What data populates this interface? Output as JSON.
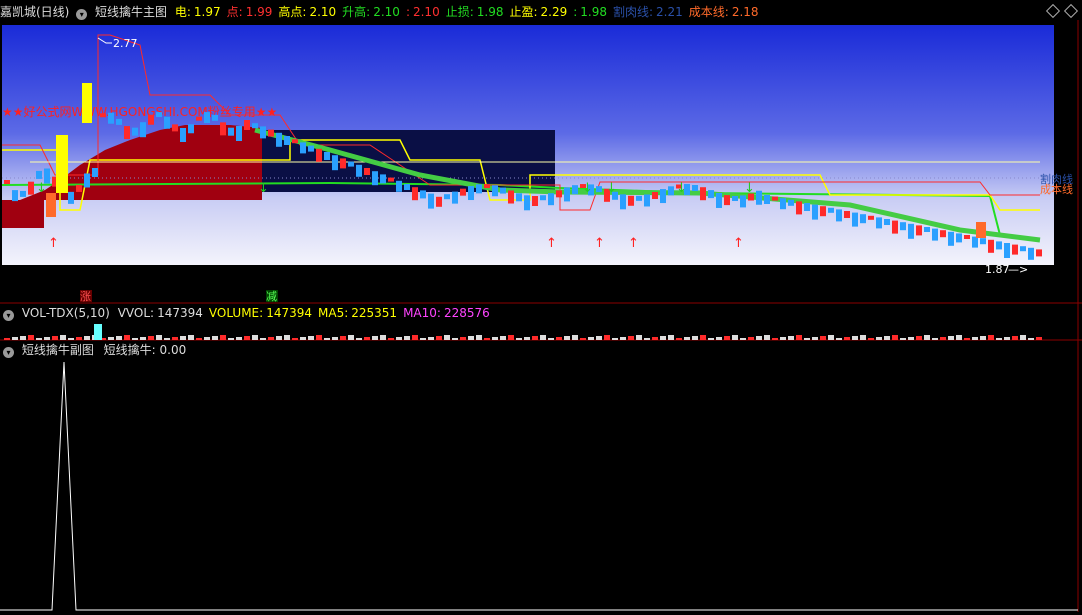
{
  "main": {
    "stock": "嘉凯城(日线)",
    "indicator": "短线擒牛主图",
    "items": [
      {
        "k": "电:",
        "v": "1.97",
        "kc": "#ffff00",
        "vc": "#ffff00"
      },
      {
        "k": "点:",
        "v": "1.99",
        "kc": "#ff3030",
        "vc": "#ff3030"
      },
      {
        "k": "高点:",
        "v": "2.10",
        "kc": "#ffff00",
        "vc": "#ffff00"
      },
      {
        "k": "升高:",
        "v": "2.10",
        "kc": "#22dd22",
        "vc": "#22dd22"
      },
      {
        "k": ":",
        "v": "2.10",
        "kc": "#ff3030",
        "vc": "#ff3030"
      },
      {
        "k": "止损:",
        "v": "1.98",
        "kc": "#22dd22",
        "vc": "#22dd22"
      },
      {
        "k": "止盈:",
        "v": "2.29",
        "kc": "#ffff00",
        "vc": "#ffff00"
      },
      {
        "k": ":",
        "v": "1.98",
        "kc": "#22dd22",
        "vc": "#22dd22"
      },
      {
        "k": "割肉线:",
        "v": "2.21",
        "kc": "#2a50a8",
        "vc": "#2a50a8"
      },
      {
        "k": "成本线:",
        "v": "2.18",
        "kc": "#ff6a2a",
        "vc": "#ff6a2a"
      }
    ],
    "watermark": "★★好公式网WWW.HGONGSHI.COM粉丝专用★★",
    "high_label": "2.77",
    "low_label": "1.87",
    "right_label_1": "割肉线",
    "right_label_2": "成本线"
  },
  "markers": {
    "up": "涨",
    "down": "减"
  },
  "volume": {
    "name": "VOL-TDX(5,10)",
    "items": [
      {
        "k": "VVOL:",
        "v": "147394",
        "c": "#dddddd"
      },
      {
        "k": "VOLUME:",
        "v": "147394",
        "c": "#ffff00"
      },
      {
        "k": "MA5:",
        "v": "225351",
        "c": "#ffff00"
      },
      {
        "k": "MA10:",
        "v": "228576",
        "c": "#ff44ff"
      }
    ]
  },
  "sub": {
    "name": "短线擒牛副图",
    "label": "短线擒牛:",
    "value": "0.00"
  },
  "colors": {
    "bg": "#000000",
    "up": "#ff2a2a",
    "down": "#2aa0ff",
    "grid": "#8b0000"
  }
}
